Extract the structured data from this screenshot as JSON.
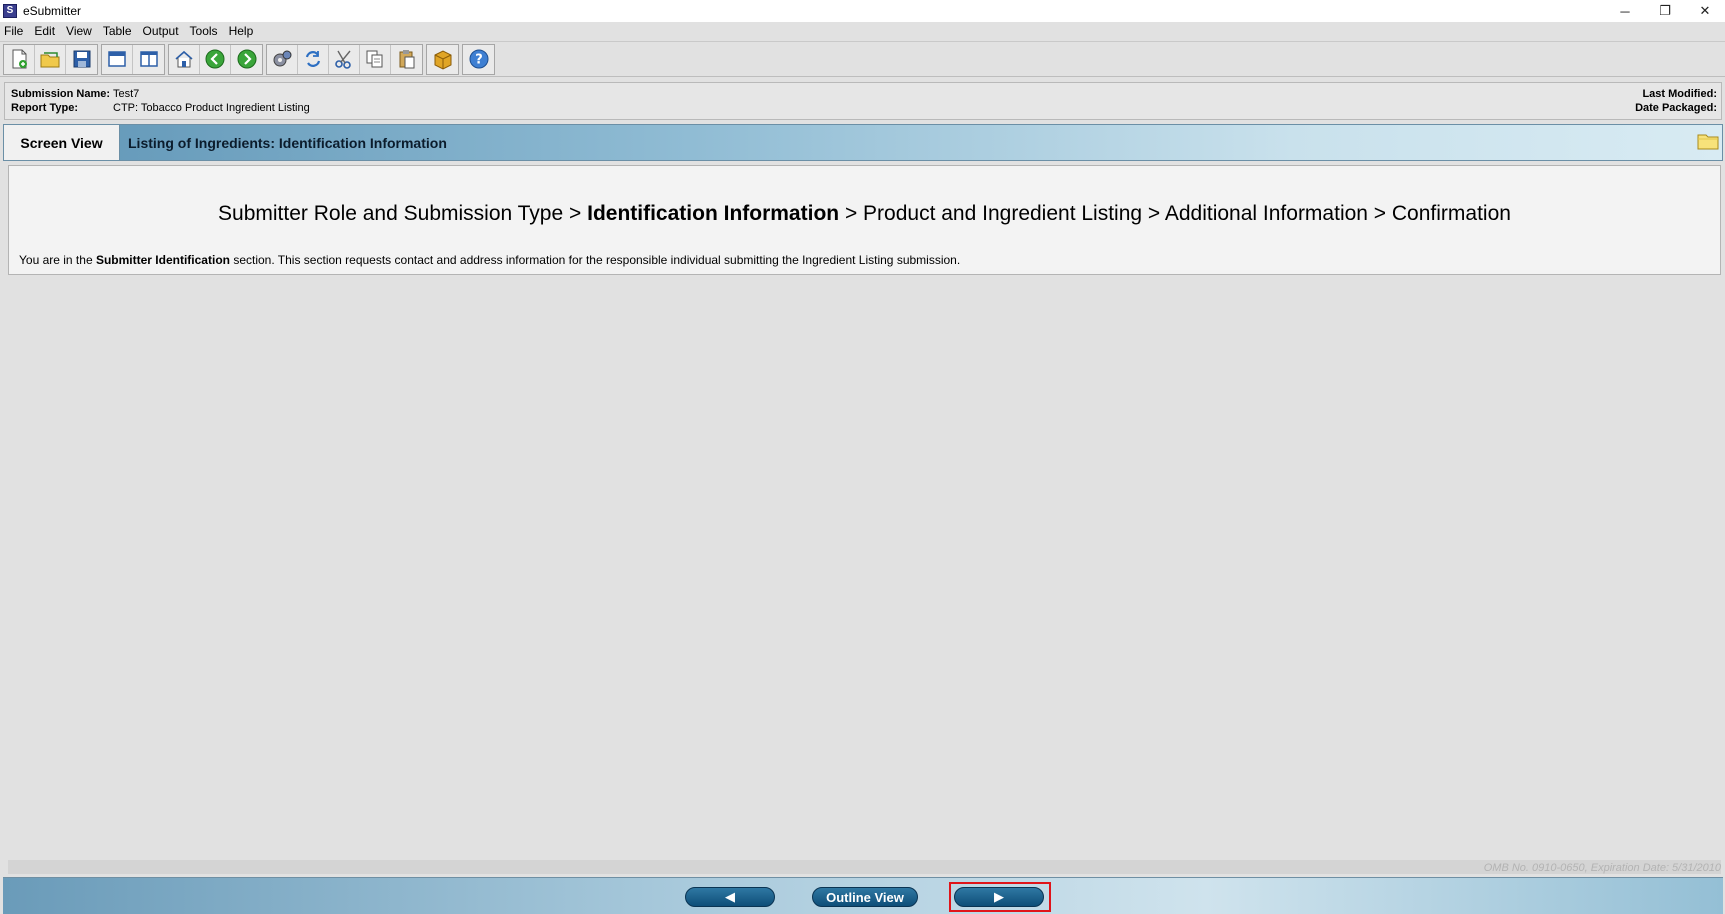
{
  "window": {
    "title": "eSubmitter",
    "app_icon_letter": "S",
    "controls": {
      "minimize": "─",
      "restore": "❐",
      "close": "✕"
    }
  },
  "menu": [
    {
      "label": "File"
    },
    {
      "label": "Edit"
    },
    {
      "label": "View"
    },
    {
      "label": "Table"
    },
    {
      "label": "Output"
    },
    {
      "label": "Tools"
    },
    {
      "label": "Help"
    }
  ],
  "info": {
    "submission_name_label": "Submission Name:",
    "submission_name": "Test7",
    "report_type_label": "Report Type:",
    "report_type": "CTP: Tobacco Product Ingredient Listing",
    "last_modified_label": "Last Modified:",
    "date_packaged_label": "Date Packaged:"
  },
  "screen_view": {
    "tab_label": "Screen View",
    "title": "Listing of Ingredients: Identification Information"
  },
  "content": {
    "crumb_1": "Submitter Role and Submission Type >",
    "crumb_current": "Identification Information",
    "crumb_rest": "> Product and Ingredient Listing > Additional Information > Confirmation",
    "desc_prefix": "You are in the",
    "desc_section": "Submitter Identification",
    "desc_suffix": "section. This section requests contact and address information for the responsible individual submitting the Ingredient Listing submission."
  },
  "footer": {
    "omb": "OMB No. 0910-0650, Expiration Date: 5/31/2010",
    "outline_view_label": "Outline View"
  },
  "icons": [
    "new-document-icon",
    "open-folder-icon",
    "save-icon",
    "window-icon",
    "split-pane-icon",
    "home-icon",
    "back-arrow-icon",
    "forward-arrow-icon",
    "settings-gear-icon",
    "refresh-icon",
    "cut-icon",
    "copy-icon",
    "paste-icon",
    "package-icon",
    "help-icon",
    "folder-icon"
  ]
}
